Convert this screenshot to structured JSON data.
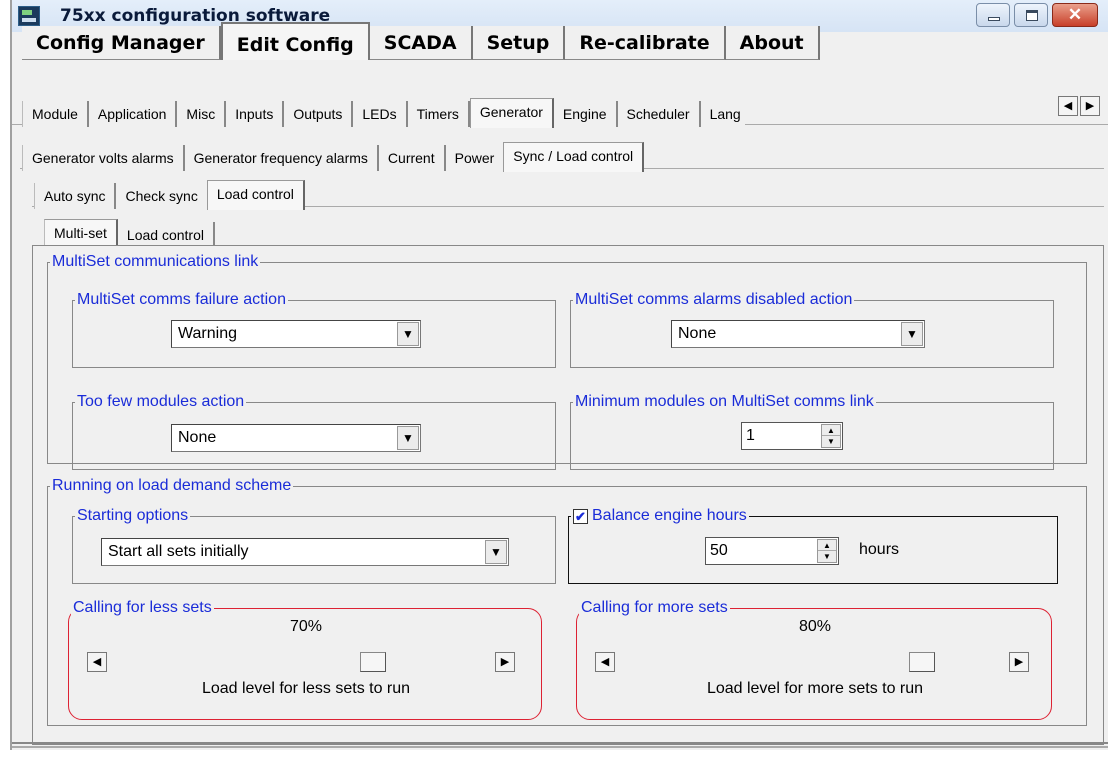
{
  "window": {
    "title": "75xx configuration software",
    "minimize_icon": "minimize-icon",
    "maximize_icon": "maximize-icon",
    "close_label": "✕"
  },
  "main_tabs": [
    {
      "label": "Config Manager",
      "active": false
    },
    {
      "label": "Edit Config",
      "active": true
    },
    {
      "label": "SCADA",
      "active": false
    },
    {
      "label": "Setup",
      "active": false
    },
    {
      "label": "Re-calibrate",
      "active": false
    },
    {
      "label": "About",
      "active": false
    }
  ],
  "config_tabs": [
    {
      "label": "Module"
    },
    {
      "label": "Application"
    },
    {
      "label": "Misc"
    },
    {
      "label": "Inputs"
    },
    {
      "label": "Outputs"
    },
    {
      "label": "LEDs"
    },
    {
      "label": "Timers"
    },
    {
      "label": "Generator",
      "active": true
    },
    {
      "label": "Engine"
    },
    {
      "label": "Scheduler"
    },
    {
      "label": "Lang"
    }
  ],
  "tab_scroll": {
    "left": "◀",
    "right": "▶"
  },
  "generator_tabs": [
    {
      "label": "Generator volts alarms"
    },
    {
      "label": "Generator frequency alarms"
    },
    {
      "label": "Current"
    },
    {
      "label": "Power"
    },
    {
      "label": "Sync / Load control",
      "active": true
    }
  ],
  "sync_tabs": [
    {
      "label": "Auto sync"
    },
    {
      "label": "Check sync"
    },
    {
      "label": "Load control",
      "active": true
    }
  ],
  "load_tabs": [
    {
      "label": "Multi-set",
      "active": true
    },
    {
      "label": "Load control"
    }
  ],
  "multiset": {
    "group_title": "MultiSet communications link",
    "failure_action": {
      "label": "MultiSet comms failure action",
      "value": "Warning"
    },
    "alarms_disabled_action": {
      "label": "MultiSet comms alarms disabled action",
      "value": "None"
    },
    "too_few_modules": {
      "label": "Too few modules action",
      "value": "None"
    },
    "min_modules": {
      "label": "Minimum modules on MultiSet comms link",
      "value": "1"
    }
  },
  "load_demand": {
    "group_title": "Running on load demand scheme",
    "starting_options": {
      "label": "Starting options",
      "value": "Start all sets initially"
    },
    "balance_hours": {
      "label": "Balance engine hours",
      "checked": true,
      "check_mark": "✔",
      "value": "50",
      "unit": "hours"
    },
    "less_sets": {
      "label": "Calling for less sets",
      "percent_text": "70%",
      "level": 0.7,
      "caption": "Load level for less sets to run"
    },
    "more_sets": {
      "label": "Calling for more sets",
      "percent_text": "80%",
      "level": 0.8,
      "caption": "Load level for more sets to run"
    }
  },
  "colors": {
    "group_title": "#1a2cd8",
    "highlight": "#dd2233"
  }
}
